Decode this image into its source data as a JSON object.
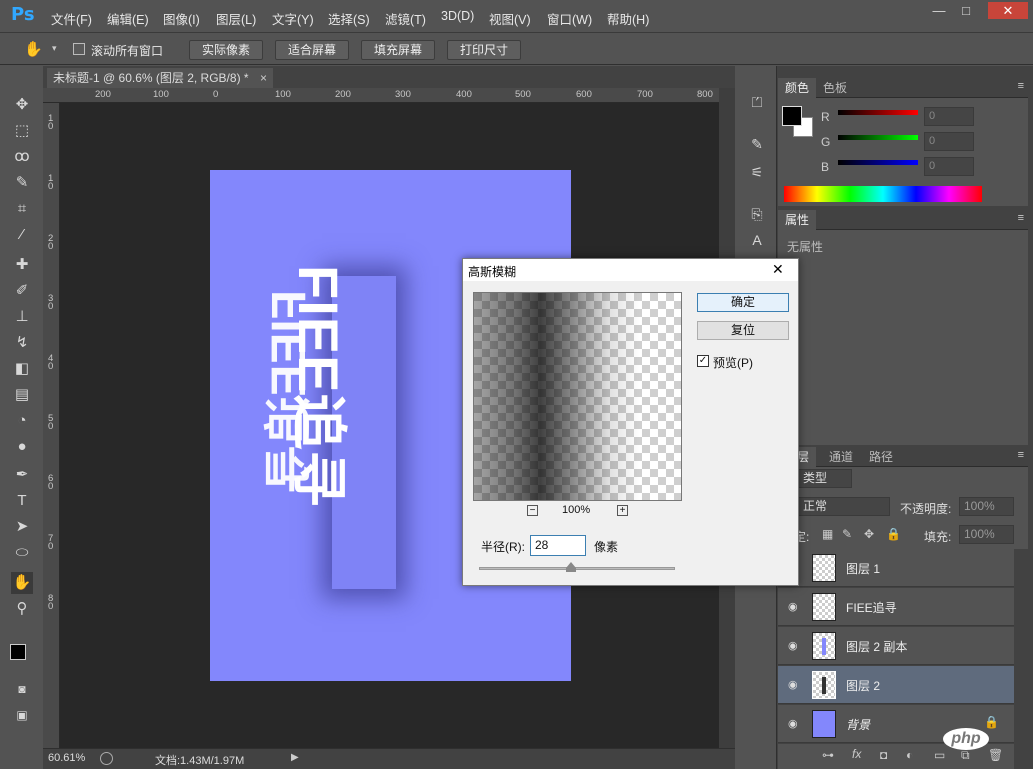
{
  "app": {
    "logo": "Ps"
  },
  "menu": [
    "文件(F)",
    "编辑(E)",
    "图像(I)",
    "图层(L)",
    "文字(Y)",
    "选择(S)",
    "滤镜(T)",
    "3D(D)",
    "视图(V)",
    "窗口(W)",
    "帮助(H)"
  ],
  "window_controls": {
    "minimize": "—",
    "maximize": "□",
    "close": "✕"
  },
  "options": {
    "scroll_all_label": "滚动所有窗口",
    "actual_pixels": "实际像素",
    "fit_screen": "适合屏幕",
    "fill_screen": "填充屏幕",
    "print_size": "打印尺寸"
  },
  "document": {
    "tab_title": "未标题-1 @ 60.6% (图层 2, RGB/8) *",
    "tab_close": "×",
    "canvas_color": "#8387fc",
    "canvas_text": "FIEE追寻"
  },
  "ruler": {
    "h_labels": [
      "200",
      "100",
      "0",
      "100",
      "200",
      "300",
      "400",
      "500",
      "600",
      "700",
      "800"
    ],
    "v_labels": [
      "1",
      "0",
      "1",
      "0",
      "2",
      "0",
      "3",
      "0",
      "4",
      "0",
      "5",
      "0",
      "6",
      "0",
      "7",
      "0",
      "8",
      "0"
    ]
  },
  "status": {
    "zoom": "60.61%",
    "doc_info": "文档:1.43M/1.97M"
  },
  "color_panel": {
    "tabs": [
      "颜色",
      "色板"
    ],
    "channels": [
      {
        "label": "R",
        "value": "0"
      },
      {
        "label": "G",
        "value": "0"
      },
      {
        "label": "B",
        "value": "0"
      }
    ]
  },
  "properties_panel": {
    "tab": "属性",
    "content": "无属性"
  },
  "layers_panel": {
    "tabs": [
      "图层",
      "通道",
      "路径"
    ],
    "filter_kind": "类型",
    "blend_mode": "正常",
    "opacity_label": "不透明度:",
    "opacity_value": "100%",
    "lock_label": "锁定:",
    "fill_label": "填充:",
    "fill_value": "100%",
    "layers": [
      {
        "name": "图层 1",
        "visible": false,
        "selected": false
      },
      {
        "name": "FIEE追寻",
        "visible": true,
        "selected": false
      },
      {
        "name": "图层 2 副本",
        "visible": true,
        "selected": false
      },
      {
        "name": "图层 2",
        "visible": true,
        "selected": true
      },
      {
        "name": "背景",
        "visible": true,
        "selected": false
      }
    ]
  },
  "dialog": {
    "title": "高斯模糊",
    "close": "✕",
    "ok": "确定",
    "reset": "复位",
    "preview_label": "预览(P)",
    "preview_checked": true,
    "zoom": "100%",
    "zoom_out": "−",
    "zoom_in": "+",
    "radius_label": "半径(R):",
    "radius_value": "28",
    "radius_unit": "像素"
  },
  "watermark": "php"
}
